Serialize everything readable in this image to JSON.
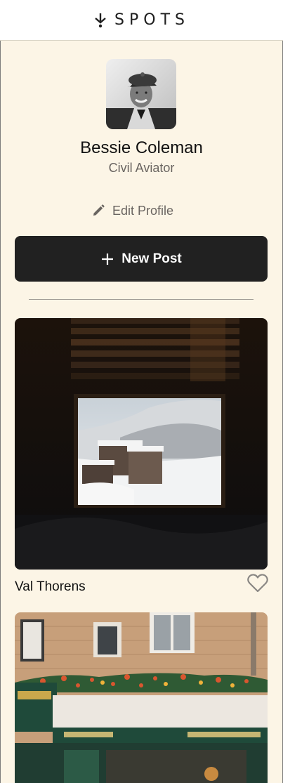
{
  "header": {
    "logo_text": "SPOTS"
  },
  "profile": {
    "name": "Bessie Coleman",
    "description": "Civil Aviator",
    "edit_label": "Edit Profile"
  },
  "actions": {
    "new_post_label": "New Post"
  },
  "cards": [
    {
      "title": "Val Thorens",
      "liked": false
    },
    {
      "title": ""
    }
  ],
  "colors": {
    "background": "#fcf5e6",
    "button": "#212121",
    "muted_text": "#6a6561"
  }
}
